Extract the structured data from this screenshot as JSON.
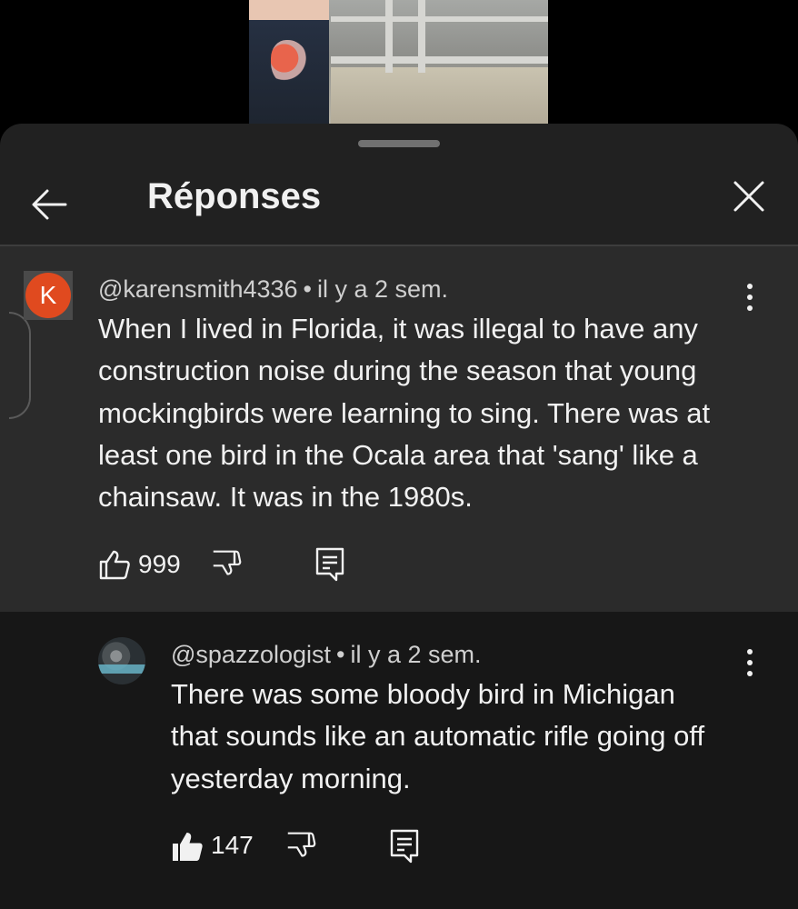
{
  "sheet": {
    "title": "Réponses"
  },
  "icons": {
    "back": "arrow-left-icon",
    "close": "close-x-icon",
    "more": "vertical-dots-icon",
    "like": "thumb-up-icon",
    "dislike": "thumb-down-icon",
    "reply": "comment-reply-icon"
  },
  "colors": {
    "sheet_bg": "#212121",
    "parent_bg": "#2b2b2b",
    "reply_bg": "#171717",
    "avatar_k": "#e04a1f"
  },
  "parent_comment": {
    "avatar_letter": "K",
    "author": "@karensmith4336",
    "separator": "•",
    "time": "il y a 2 sem.",
    "text_lines": [
      "When I lived in Florida, it was illegal to have any",
      "construction noise during the season that young",
      "mockingbirds were learning to sing. There was at",
      "least one bird in the Ocala area that 'sang' like a",
      "chainsaw. It was in the 1980s."
    ],
    "likes": "999",
    "liked": false
  },
  "reply_comment": {
    "author": "@spazzologist",
    "separator": "•",
    "time": "il y a 2 sem.",
    "text_lines": [
      "There was some bloody bird in Michigan",
      "that sounds like an automatic rifle going off",
      "yesterday morning."
    ],
    "likes": "147",
    "liked": true
  }
}
